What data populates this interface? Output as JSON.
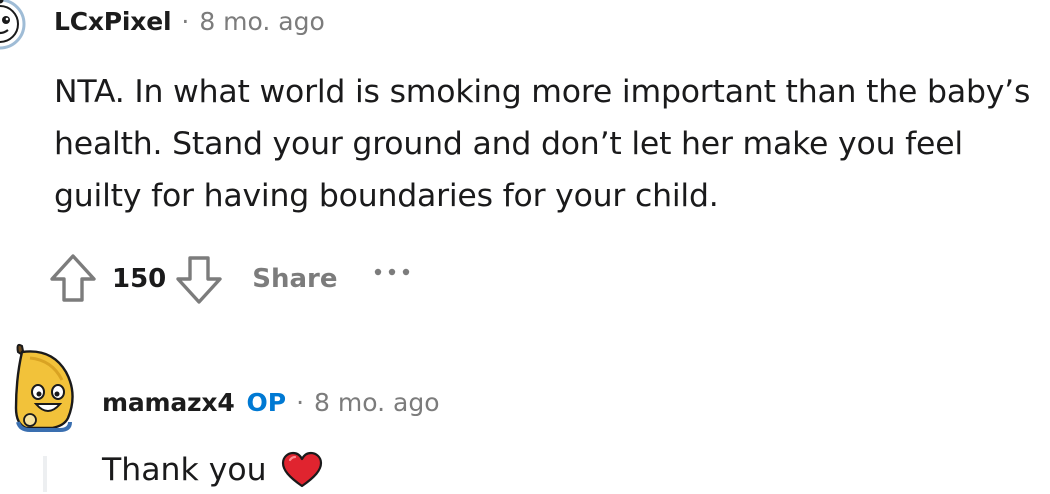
{
  "comments": [
    {
      "avatar_icon": "snoo-avatar-icon",
      "username": "LCxPixel",
      "separator": "·",
      "timestamp": "8 mo. ago",
      "body": "NTA. In what world is smoking more important than the baby’s health. Stand your ground and don’t let her make you feel guilty for having boundaries for your child.",
      "actions": {
        "upvote_icon": "upvote-arrow-icon",
        "score": "150",
        "downvote_icon": "downvote-arrow-icon",
        "share_label": "Share",
        "more_icon": "ellipsis-icon"
      }
    },
    {
      "avatar_icon": "banana-avatar-icon",
      "username": "mamazx4",
      "badge": "OP",
      "separator": "·",
      "timestamp": "8 mo. ago",
      "body": "Thank you",
      "emoji_icon": "red-heart-icon"
    }
  ],
  "colors": {
    "text": "#1a1a1b",
    "muted": "#7c7c7c",
    "op_badge": "#0079d3",
    "heart": "#e0242f",
    "thread_line": "#edeff1"
  }
}
